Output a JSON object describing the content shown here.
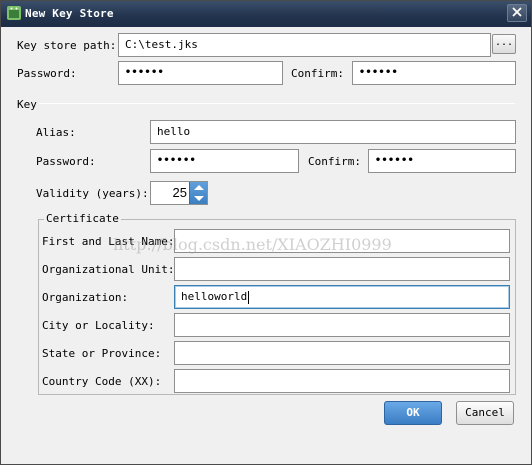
{
  "window": {
    "title": "New Key Store"
  },
  "keystore": {
    "path_label": "Key store path:",
    "path_value": "C:\\test.jks",
    "browse_label": "...",
    "password_label": "Password:",
    "password_value": "••••••",
    "confirm_label": "Confirm:",
    "confirm_value": "••••••"
  },
  "key": {
    "section_label": "Key",
    "alias_label": "Alias:",
    "alias_value": "hello",
    "password_label": "Password:",
    "password_value": "••••••",
    "confirm_label": "Confirm:",
    "confirm_value": "••••••",
    "validity_label": "Validity (years):",
    "validity_value": "25"
  },
  "certificate": {
    "legend": "Certificate",
    "first_last_label": "First and Last Name:",
    "first_last_value": "",
    "org_unit_label": "Organizational Unit:",
    "org_unit_value": "",
    "organization_label": "Organization:",
    "organization_value": "helloworld",
    "city_label": "City or Locality:",
    "city_value": "",
    "state_label": "State or Province:",
    "state_value": "",
    "country_label": "Country Code (XX):",
    "country_value": ""
  },
  "watermark": "http://blog.csdn.net/XIAOZHI0999",
  "buttons": {
    "ok": "OK",
    "cancel": "Cancel"
  },
  "colors": {
    "titlebar": "#22334d",
    "primary_button": "#3b7dc4",
    "focus_border": "#3c7fb1"
  }
}
